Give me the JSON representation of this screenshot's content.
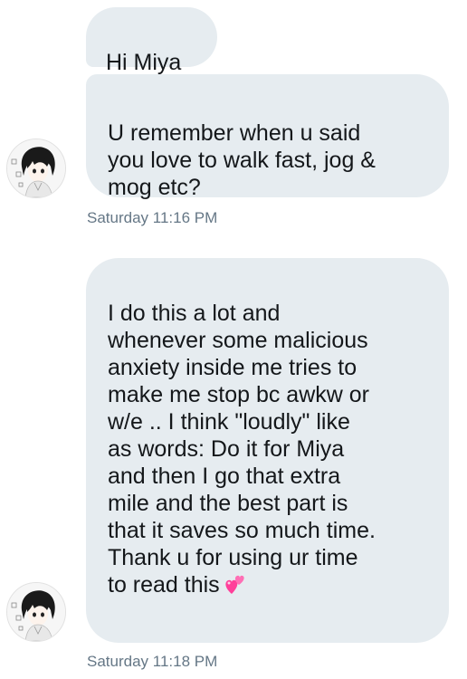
{
  "messages": [
    {
      "text": "Hi Miya"
    },
    {
      "text": "U remember when u said\nyou love to walk fast, jog &\nmog etc?"
    },
    {
      "text": "I do this a lot and\nwhenever some malicious\nanxiety inside me tries to\nmake me stop bc awkw or\nw/e .. I think \"loudly\" like\nas words: Do it for Miya\nand then I go that extra\nmile and the best part is\nthat it saves so much time.\nThank u for using ur time\nto read this",
      "emoji": "two-hearts-icon"
    }
  ],
  "timestamps": [
    "Saturday 11:16 PM",
    "Saturday 11:18 PM"
  ],
  "colors": {
    "bubble_bg": "#e6ecf0",
    "text": "#14171a",
    "timestamp": "#657786",
    "heart": "#ff3f9a"
  }
}
